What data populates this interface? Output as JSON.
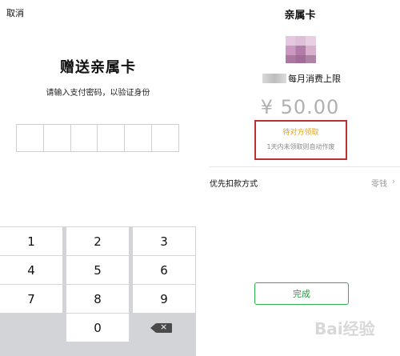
{
  "left": {
    "cancel": "取消",
    "title": "赠送亲属卡",
    "hint": "请输入支付密码，以验证身份",
    "keys": {
      "k1": "1",
      "k2": "2",
      "k3": "3",
      "k4": "4",
      "k5": "5",
      "k6": "6",
      "k7": "7",
      "k8": "8",
      "k9": "9",
      "k0": "0"
    },
    "delete_icon": "backspace-icon"
  },
  "right": {
    "title": "亲属卡",
    "limit_label": "每月消费上限",
    "amount": "¥ 50.00",
    "status": "待对方领取",
    "status_note": "1天内未领取则自动作废",
    "pay_method_label": "优先扣款方式",
    "pay_method_value": "零钱",
    "done_button": "完成"
  },
  "watermark": "Bai经验",
  "colors": {
    "accent_green": "#2db44a",
    "status_orange": "#e0a020",
    "highlight_red": "#b83030"
  }
}
